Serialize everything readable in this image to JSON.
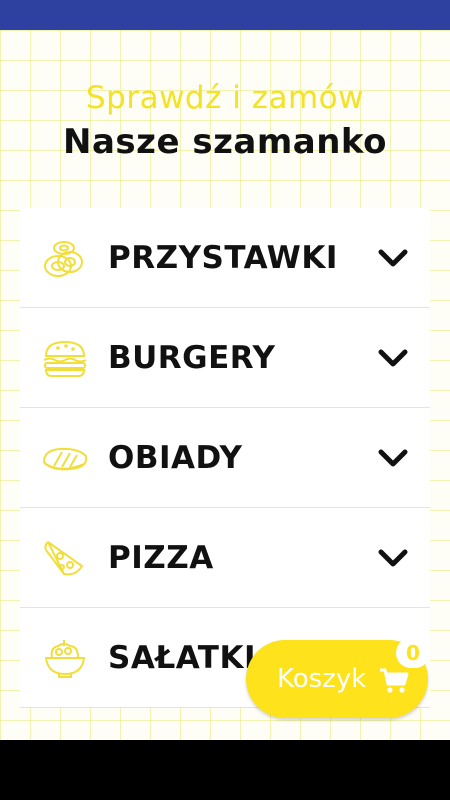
{
  "header": {
    "subtitle": "Sprawdź i zamów",
    "title": "Nasze szamanko"
  },
  "menu": {
    "items": [
      {
        "label": "PRZYSTAWKI",
        "icon": "onion-rings-icon"
      },
      {
        "label": "BURGERY",
        "icon": "burger-icon"
      },
      {
        "label": "OBIADY",
        "icon": "steak-icon"
      },
      {
        "label": "PIZZA",
        "icon": "pizza-slice-icon"
      },
      {
        "label": "SAŁATKI",
        "icon": "salad-bowl-icon"
      }
    ]
  },
  "cart": {
    "label": "Koszyk",
    "count": "0"
  },
  "colors": {
    "accent": "#fde21c",
    "status_bar": "#2e40a0",
    "text": "#111111"
  }
}
